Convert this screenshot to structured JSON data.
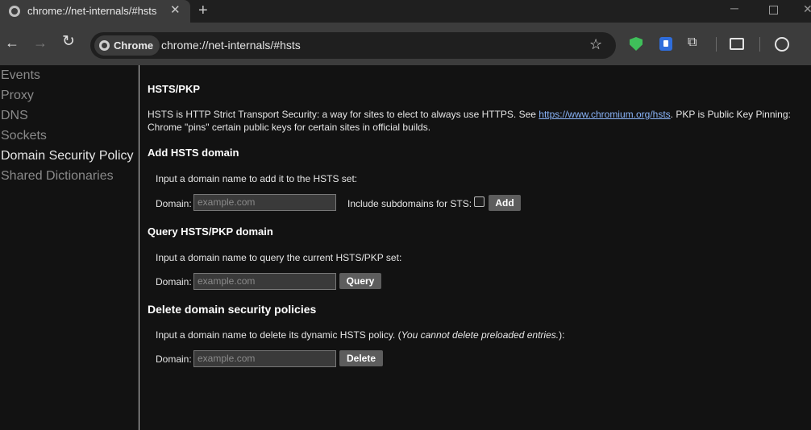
{
  "tab": {
    "title": "chrome://net-internals/#hsts",
    "close_glyph": "✕",
    "new_tab_glyph": "+"
  },
  "window": {
    "minimize": "─",
    "close": "✕"
  },
  "toolbar": {
    "back": "←",
    "forward": "→",
    "reload": "↻",
    "chip_label": "Chrome",
    "url": "chrome://net-internals/#hsts",
    "star": "☆",
    "puzzle": "⧉",
    "menu": "⋮",
    "colors": {
      "shield": "#3fbf5a",
      "ext_blue": "#2f6ddb"
    }
  },
  "sidebar": {
    "items": [
      {
        "label": "Events"
      },
      {
        "label": "Proxy"
      },
      {
        "label": "DNS"
      },
      {
        "label": "Sockets"
      },
      {
        "label": "Domain Security Policy"
      },
      {
        "label": "Shared Dictionaries"
      }
    ],
    "active": "Domain Security Policy"
  },
  "main": {
    "title": "HSTS/PKP",
    "intro_pre": "HSTS is HTTP Strict Transport Security: a way for sites to elect to always use HTTPS. See ",
    "intro_link": "https://www.chromium.org/hsts",
    "intro_post": ". PKP is Public Key Pinning: Chrome \"pins\" certain public keys for certain sites in official builds.",
    "add": {
      "heading": "Add HSTS domain",
      "instruction": "Input a domain name to add it to the HSTS set:",
      "domain_label": "Domain:",
      "placeholder": "example.com",
      "subdomains_label": "Include subdomains for STS:",
      "button": "Add"
    },
    "query": {
      "heading": "Query HSTS/PKP domain",
      "instruction": "Input a domain name to query the current HSTS/PKP set:",
      "domain_label": "Domain:",
      "placeholder": "example.com",
      "button": "Query"
    },
    "delete": {
      "heading": "Delete domain security policies",
      "instruction_pre": "Input a domain name to delete its dynamic HSTS policy. (",
      "instruction_em": "You cannot delete preloaded entries.",
      "instruction_post": "):",
      "domain_label": "Domain:",
      "placeholder": "example.com",
      "button": "Delete"
    }
  }
}
